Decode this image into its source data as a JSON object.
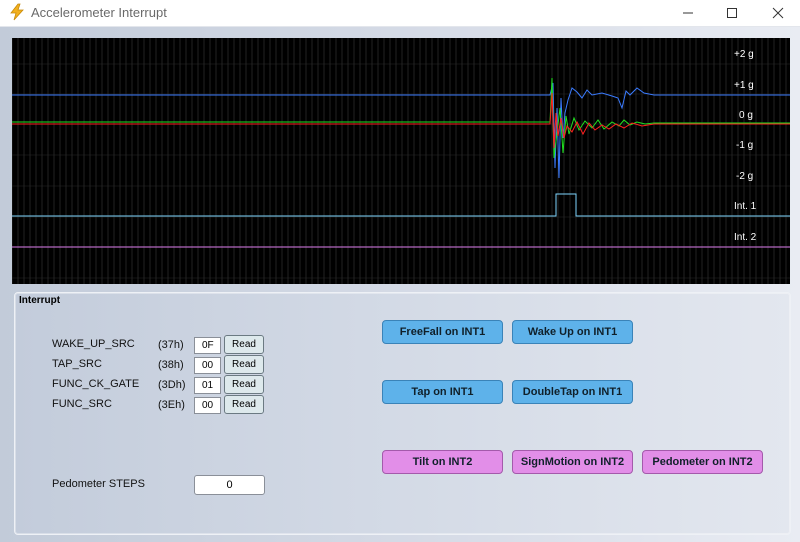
{
  "window": {
    "title": "Accelerometer Interrupt",
    "controls": [
      "minimize",
      "maximize",
      "close"
    ]
  },
  "scope": {
    "y_labels": [
      "+2 g",
      "+1 g",
      "0 g",
      "-1 g",
      "-2 g",
      "Int. 1",
      "Int. 2"
    ],
    "trace_colors": {
      "x": "#ff2020",
      "y": "#20e020",
      "z": "#3a7bff",
      "int1": "#7fd6ff",
      "int2": "#e07ff0"
    },
    "grid_color": "#3a3a3a"
  },
  "interrupt_panel": {
    "title": "Interrupt",
    "registers": [
      {
        "name": "WAKE_UP_SRC",
        "addr": "(37h)",
        "value": "0F",
        "button": "Read"
      },
      {
        "name": "TAP_SRC",
        "addr": "(38h)",
        "value": "00",
        "button": "Read"
      },
      {
        "name": "FUNC_CK_GATE",
        "addr": "(3Dh)",
        "value": "01",
        "button": "Read"
      },
      {
        "name": "FUNC_SRC",
        "addr": "(3Eh)",
        "value": "00",
        "button": "Read"
      }
    ],
    "pedometer": {
      "label": "Pedometer STEPS",
      "value": "0"
    },
    "buttons": {
      "freefall": "FreeFall on INT1",
      "wakeup": "Wake Up on INT1",
      "tap": "Tap on INT1",
      "doubletap": "DoubleTap on INT1",
      "tilt": "Tilt on INT2",
      "signmotion": "SignMotion on INT2",
      "pedometer": "Pedometer on INT2"
    },
    "colors": {
      "int1": "#5eb2ea",
      "int2": "#e28ee8"
    }
  }
}
